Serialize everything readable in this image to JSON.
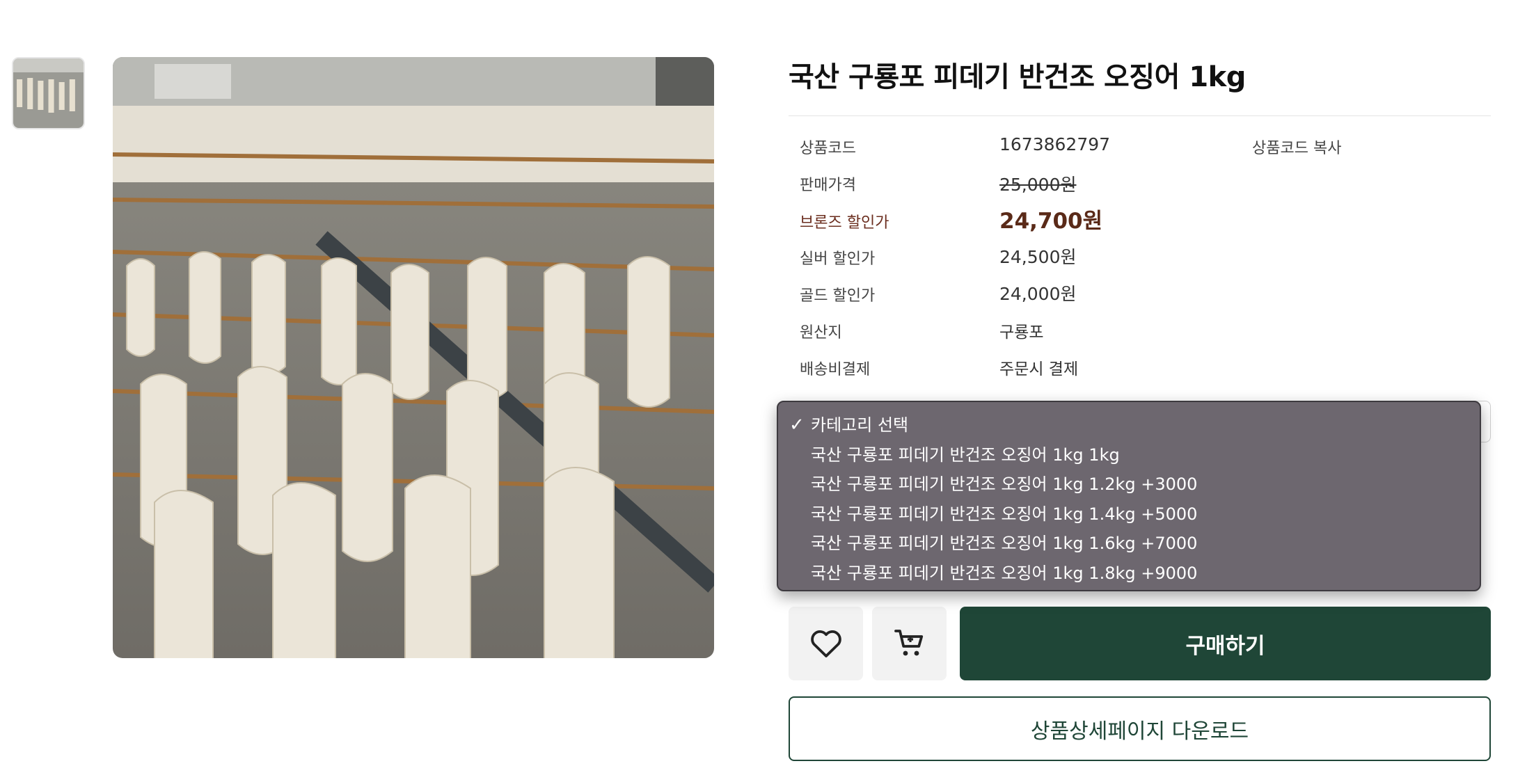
{
  "product": {
    "title": "국산 구룡포 피데기 반건조 오징어 1kg",
    "thumbnail_alt": "squid-drying-photo",
    "main_photo_alt": "squid-drying-photo"
  },
  "info": {
    "code_label": "상품코드",
    "code_value": "1673862797",
    "code_copy": "상품코드 복사",
    "price_label": "판매가격",
    "price_value": "25,000원",
    "bronze_label": "브론즈 할인가",
    "bronze_value": "24,700원",
    "silver_label": "실버 할인가",
    "silver_value": "24,500원",
    "gold_label": "골드 할인가",
    "gold_value": "24,000원",
    "origin_label": "원산지",
    "origin_value": "구룡포",
    "shipping_label": "배송비결제",
    "shipping_value": "주문시 결제"
  },
  "dropdown": {
    "check_glyph": "✓",
    "options": [
      "카테고리 선택",
      "국산 구룡포 피데기 반건조 오징어 1kg 1kg",
      "국산 구룡포 피데기 반건조 오징어 1kg 1.2kg +3000",
      "국산 구룡포 피데기 반건조 오징어 1kg 1.4kg +5000",
      "국산 구룡포 피데기 반건조 오징어 1kg 1.6kg +7000",
      "국산 구룡포 피데기 반건조 오징어 1kg 1.8kg +9000"
    ]
  },
  "actions": {
    "wishlist_icon": "heart-icon",
    "cart_icon": "cart-icon",
    "buy_label": "구매하기",
    "download_label": "상품상세페이지 다운로드"
  },
  "colors": {
    "brand_green": "#1f4637",
    "bronze": "#5a2a18",
    "dropdown_bg": "#6d676f"
  }
}
